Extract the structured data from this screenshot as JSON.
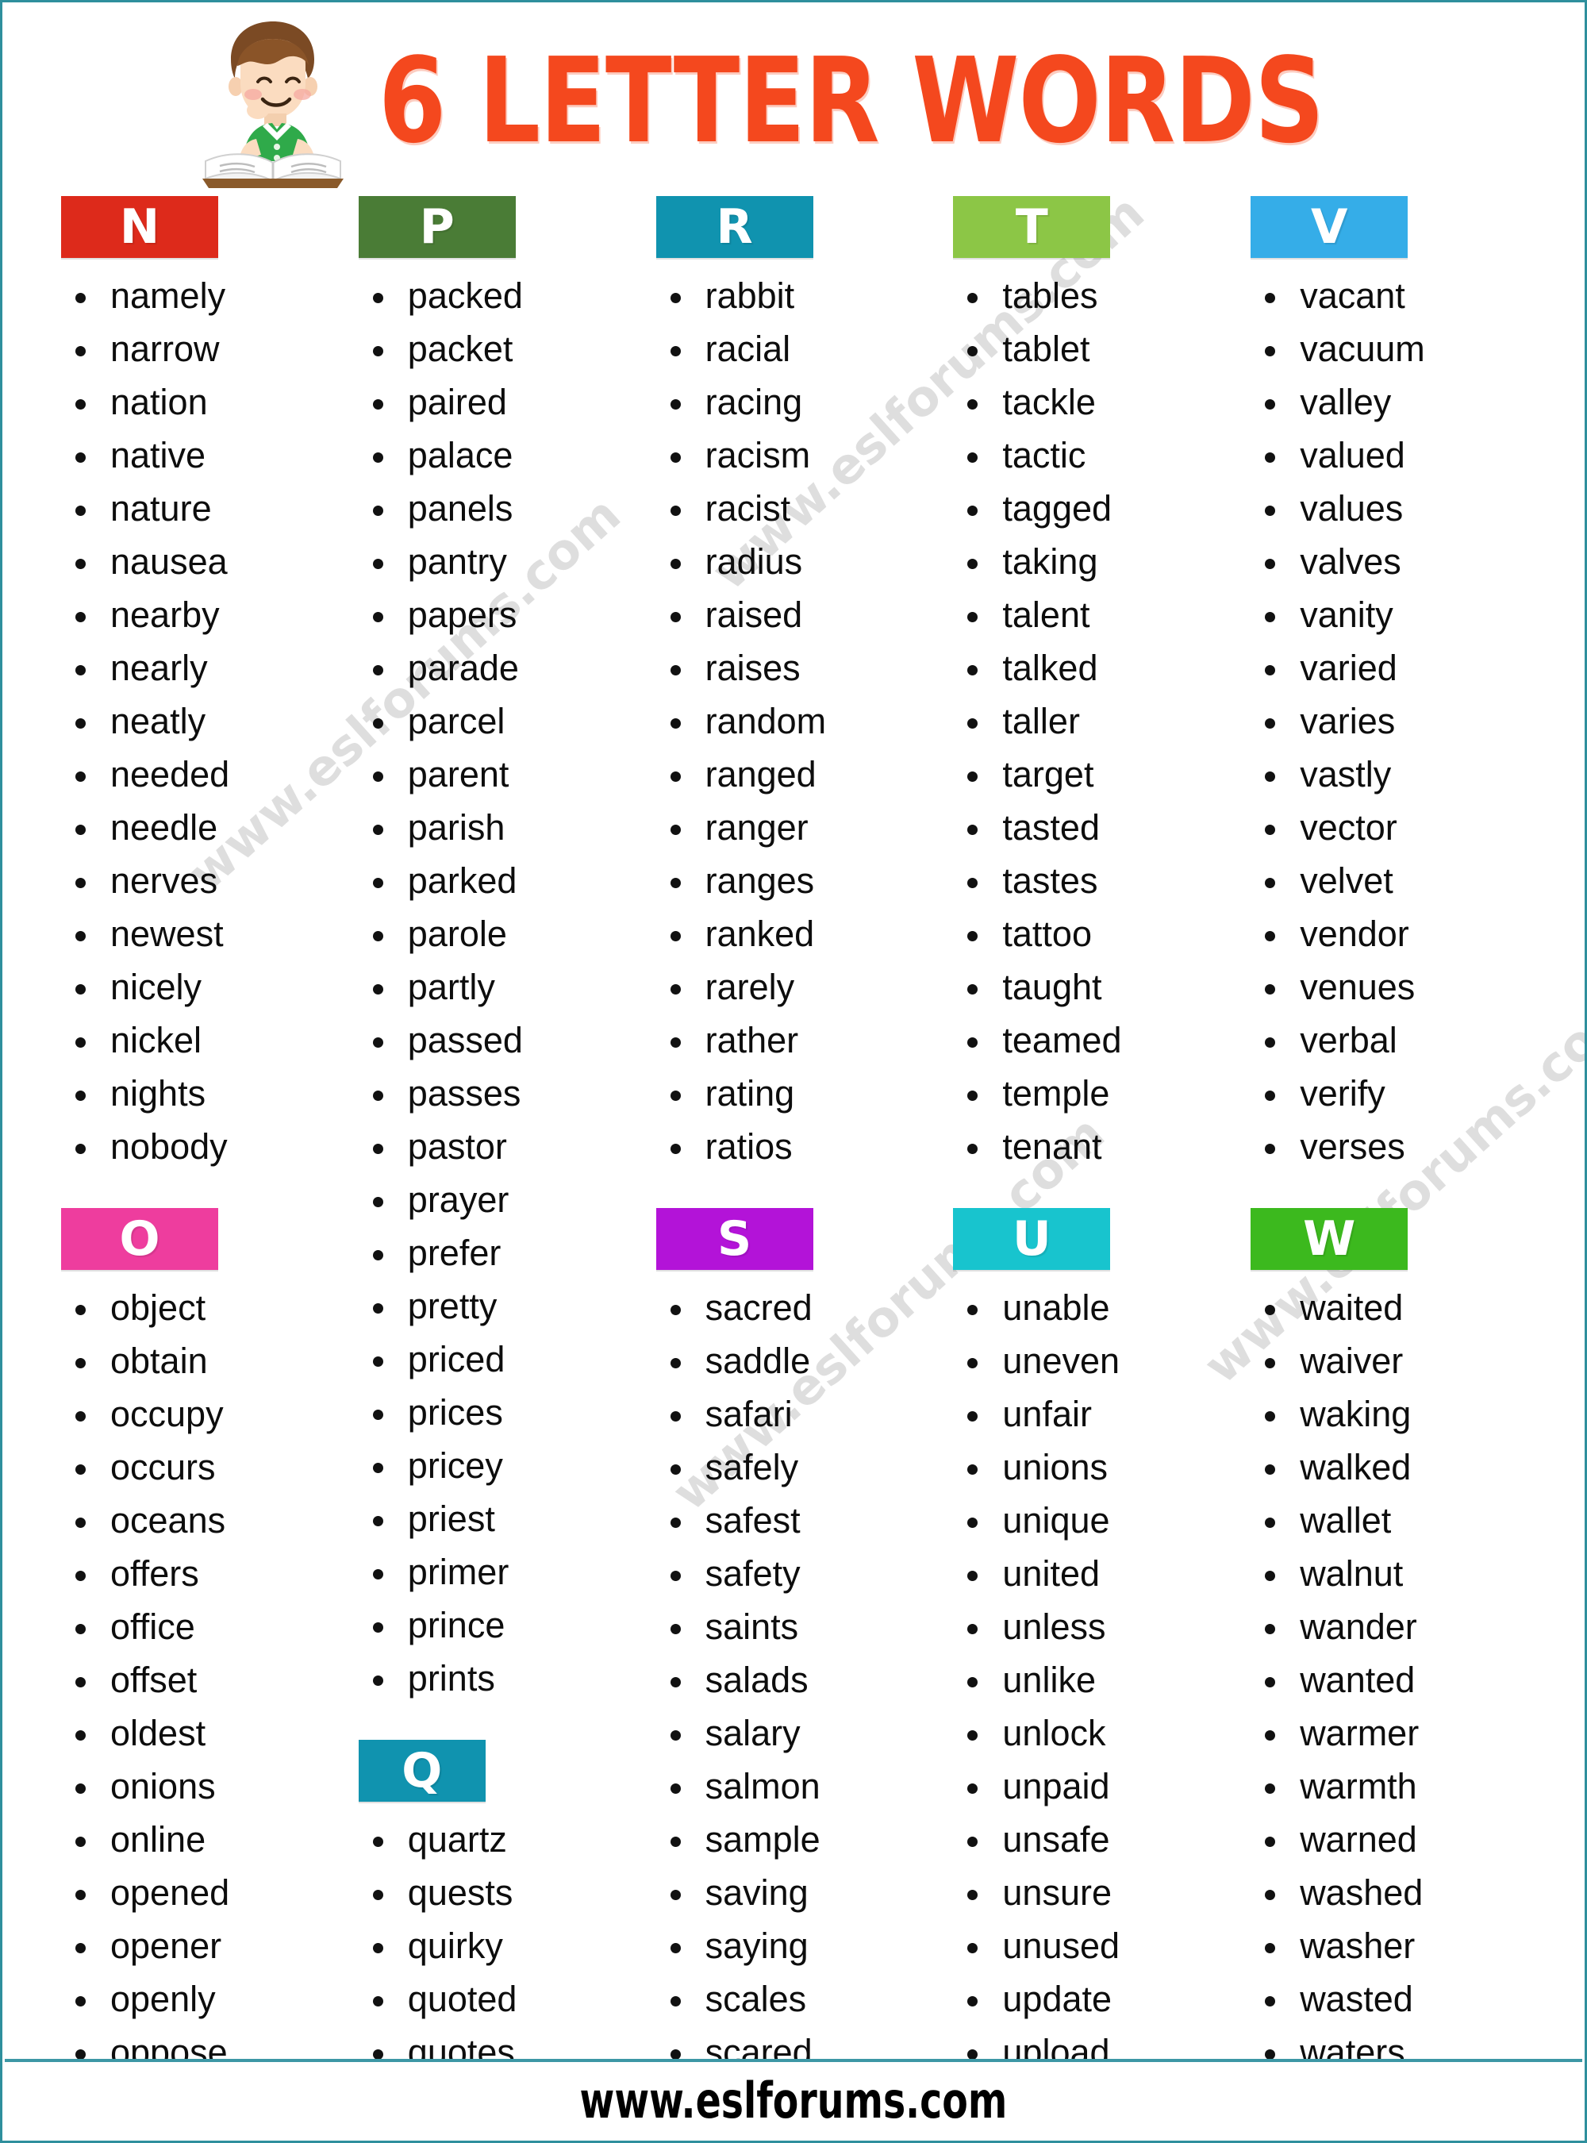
{
  "header": {
    "title": "6 LETTER WORDS",
    "illustration": "boy-reading-book"
  },
  "watermarks": [
    "www.eslforums.com",
    "www.eslforums.com",
    "www.eslforums.com",
    "www.eslforums.com"
  ],
  "footer": {
    "site": "www.eslforums.com"
  },
  "colors": {
    "title": "#f4481e",
    "border": "#2f8f9d",
    "letter_N": "#dd2a1b",
    "letter_O": "#ee3d9e",
    "letter_P": "#4a7c36",
    "letter_Q": "#1093af",
    "letter_R": "#1093af",
    "letter_S": "#b313d8",
    "letter_T": "#8cc646",
    "letter_U": "#18c4ce",
    "letter_V": "#35ade8",
    "letter_W": "#3cb91e"
  },
  "columns": [
    {
      "sections": [
        {
          "letter": "N",
          "color": "#dd2a1b",
          "words": [
            "namely",
            "narrow",
            "nation",
            "native",
            "nature",
            "nausea",
            "nearby",
            "nearly",
            "neatly",
            "needed",
            "needle",
            "nerves",
            "newest",
            "nicely",
            "nickel",
            "nights",
            "nobody"
          ]
        },
        {
          "letter": "O",
          "color": "#ee3d9e",
          "words": [
            "object",
            "obtain",
            "occupy",
            "occurs",
            "oceans",
            "offers",
            "office",
            "offset",
            "oldest",
            "onions",
            "online",
            "opened",
            "opener",
            "openly",
            "oppose"
          ]
        }
      ]
    },
    {
      "sections": [
        {
          "letter": "P",
          "color": "#4a7c36",
          "words": [
            "packed",
            "packet",
            "paired",
            "palace",
            "panels",
            "pantry",
            "papers",
            "parade",
            "parcel",
            "parent",
            "parish",
            "parked",
            "parole",
            "partly",
            "passed",
            "passes",
            "pastor",
            "prayer",
            "prefer",
            "pretty",
            "priced",
            "prices",
            "pricey",
            "priest",
            "primer",
            "prince",
            "prints"
          ]
        },
        {
          "letter": "Q",
          "color": "#1093af",
          "words": [
            "quartz",
            "quests",
            "quirky",
            "quoted",
            "quotes"
          ]
        }
      ]
    },
    {
      "sections": [
        {
          "letter": "R",
          "color": "#1093af",
          "words": [
            "rabbit",
            "racial",
            "racing",
            "racism",
            "racist",
            "radius",
            "raised",
            "raises",
            "random",
            "ranged",
            "ranger",
            "ranges",
            "ranked",
            "rarely",
            "rather",
            "rating",
            "ratios"
          ]
        },
        {
          "letter": "S",
          "color": "#b313d8",
          "words": [
            "sacred",
            "saddle",
            "safari",
            "safely",
            "safest",
            "safety",
            "saints",
            "salads",
            "salary",
            "salmon",
            "sample",
            "saving",
            "saying",
            "scales",
            "scared"
          ]
        }
      ]
    },
    {
      "sections": [
        {
          "letter": "T",
          "color": "#8cc646",
          "words": [
            "tables",
            "tablet",
            "tackle",
            "tactic",
            "tagged",
            "taking",
            "talent",
            "talked",
            "taller",
            "target",
            "tasted",
            "tastes",
            "tattoo",
            "taught",
            "teamed",
            "temple",
            "tenant"
          ]
        },
        {
          "letter": "U",
          "color": "#18c4ce",
          "words": [
            "unable",
            "uneven",
            "unfair",
            "unions",
            "unique",
            "united",
            "unless",
            "unlike",
            "unlock",
            "unpaid",
            "unsafe",
            "unsure",
            "unused",
            "update",
            "upload"
          ]
        }
      ]
    },
    {
      "sections": [
        {
          "letter": "V",
          "color": "#35ade8",
          "words": [
            "vacant",
            "vacuum",
            "valley",
            "valued",
            "values",
            "valves",
            "vanity",
            "varied",
            "varies",
            "vastly",
            "vector",
            "velvet",
            "vendor",
            "venues",
            "verbal",
            "verify",
            "verses"
          ]
        },
        {
          "letter": "W",
          "color": "#3cb91e",
          "words": [
            "waited",
            "waiver",
            "waking",
            "walked",
            "wallet",
            "walnut",
            "wander",
            "wanted",
            "warmer",
            "warmth",
            "warned",
            "washed",
            "washer",
            "wasted",
            "waters"
          ]
        }
      ]
    }
  ]
}
